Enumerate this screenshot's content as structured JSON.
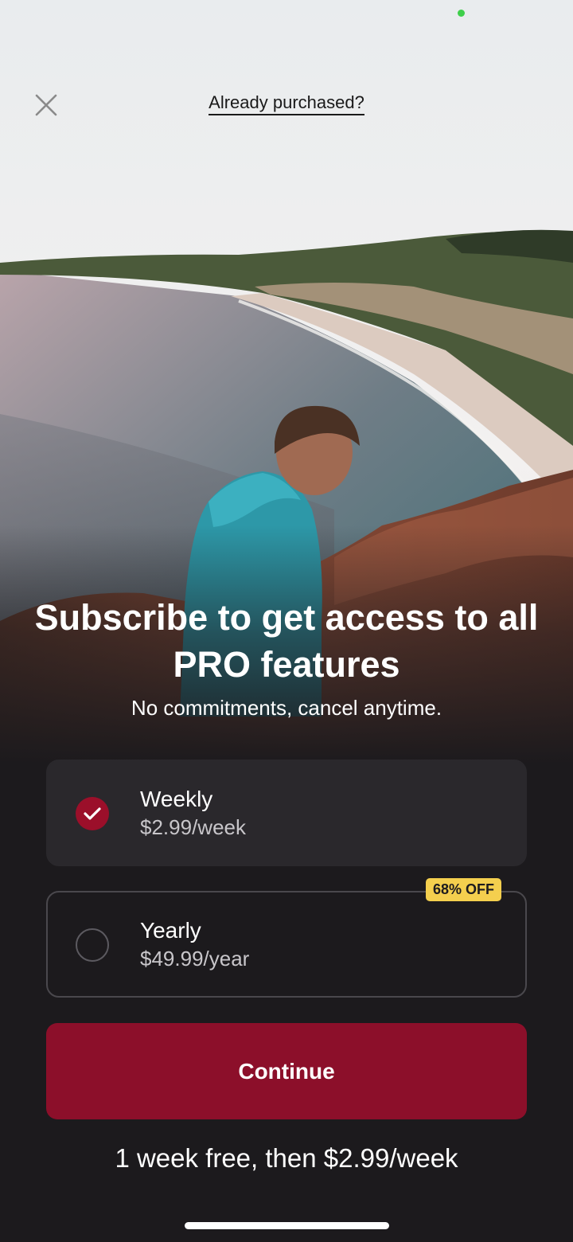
{
  "header": {
    "restore_label": "Already purchased?",
    "close_icon": "close-icon"
  },
  "hero": {
    "title": "Subscribe to get access to all PRO features",
    "subtitle": "No commitments, cancel anytime."
  },
  "plans": [
    {
      "name": "Weekly",
      "price": "$2.99/week",
      "selected": true,
      "badge": ""
    },
    {
      "name": "Yearly",
      "price": "$49.99/year",
      "selected": false,
      "badge": "68% OFF"
    }
  ],
  "cta": {
    "label": "Continue"
  },
  "footer": {
    "trial_note": "1 week free, then $2.99/week"
  },
  "colors": {
    "background": "#1c1a1d",
    "accent": "#8c0f2a",
    "badge": "#f4cf4e",
    "status_dot": "#3ecf4a"
  }
}
